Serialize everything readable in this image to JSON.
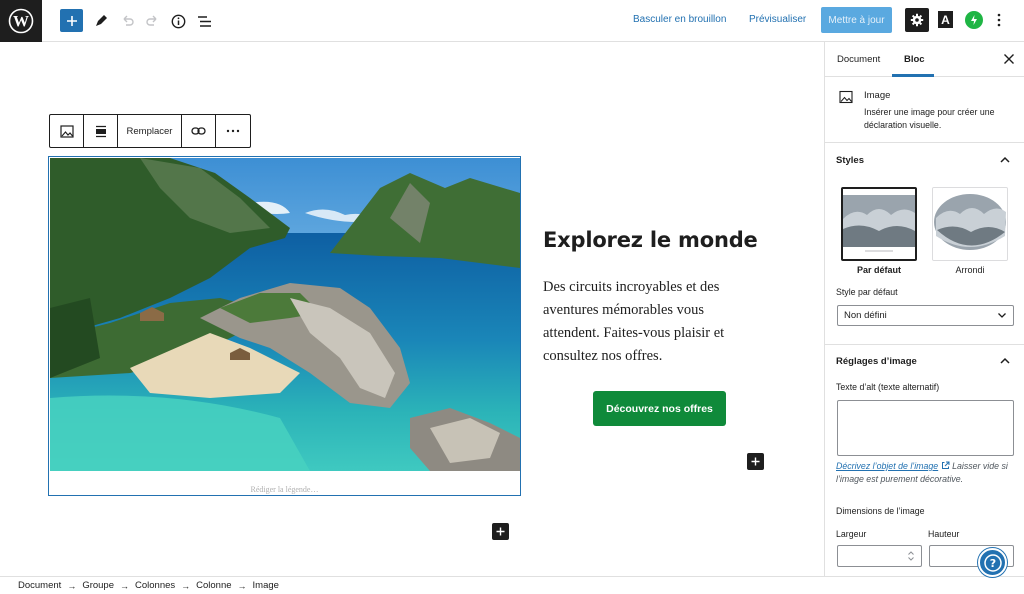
{
  "topbar": {
    "switch_draft": "Basculer en brouillon",
    "preview": "Prévisualiser",
    "update": "Mettre à jour",
    "a_label": "A"
  },
  "block_toolbar": {
    "replace": "Remplacer"
  },
  "content": {
    "caption_placeholder": "Rédiger la légende…",
    "heading": "Explorez le monde",
    "paragraph": "Des circuits incroyables et des aventures mémorables vous attendent. Faites-vous plaisir et consultez nos offres.",
    "cta": "Découvrez nos offres"
  },
  "breadcrumb": [
    "Document",
    "Groupe",
    "Colonnes",
    "Colonne",
    "Image"
  ],
  "sidebar": {
    "tab_document": "Document",
    "tab_block": "Bloc",
    "block_title": "Image",
    "block_desc": "Insérer une image pour créer une déclaration visuelle.",
    "styles_title": "Styles",
    "style_default": "Par défaut",
    "style_rounded": "Arrondi",
    "default_style_label": "Style par défaut",
    "default_style_value": "Non défini",
    "image_settings_title": "Réglages d’image",
    "alt_label": "Texte d’alt (texte alternatif)",
    "alt_value": "",
    "alt_help_link": "Décrivez l’objet de l’image",
    "alt_help_text": "Laisser vide si l’image est purement décorative.",
    "dimensions_label": "Dimensions de l’image",
    "width_label": "Largeur",
    "height_label": "Hauteur"
  },
  "colors": {
    "accent": "#2271b1",
    "cta": "#0f8a3a",
    "dark": "#1e1e1e"
  },
  "icons": [
    "wordpress-logo",
    "plus-icon",
    "pencil-icon",
    "undo-icon",
    "redo-icon",
    "info-icon",
    "list-view-icon",
    "gear-icon",
    "jetpack-icon",
    "more-vertical-icon",
    "image-icon",
    "align-icon",
    "link-icon",
    "more-horizontal-icon",
    "close-icon",
    "chevron-up-icon",
    "chevron-down-icon",
    "external-link-icon",
    "help-icon"
  ]
}
